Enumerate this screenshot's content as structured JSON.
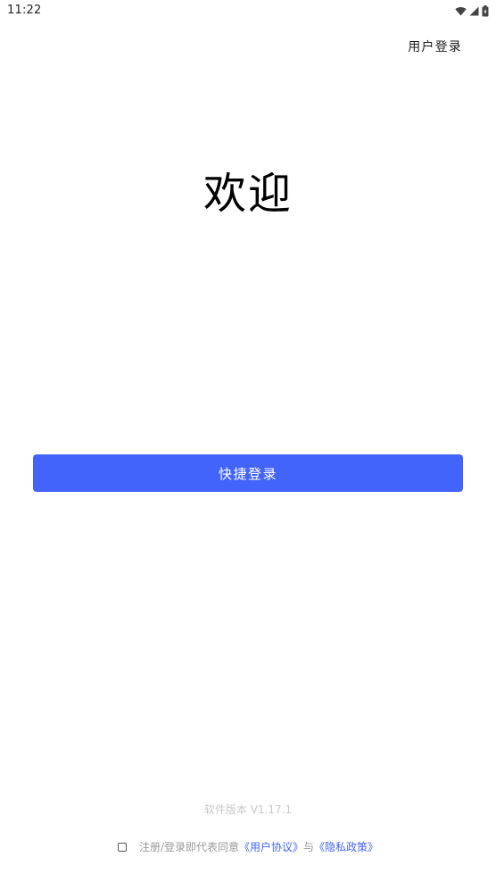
{
  "status_bar": {
    "time": "11:22",
    "icons": [
      "wifi-icon",
      "signal-icon",
      "battery-icon"
    ]
  },
  "header": {
    "user_login": "用户登录"
  },
  "main": {
    "welcome": "欢迎",
    "quick_login_label": "快捷登录"
  },
  "footer": {
    "version": "软件版本 V1.17.1",
    "agreement_prefix": "注册/登录即代表同意",
    "user_agreement": "《用户协议》",
    "conjunction": "与",
    "privacy_policy": "《隐私政策》",
    "checkbox_checked": false
  },
  "colors": {
    "accent": "#4364fa",
    "muted_text": "#9a9a9a",
    "version_text": "#c8c8c8"
  }
}
